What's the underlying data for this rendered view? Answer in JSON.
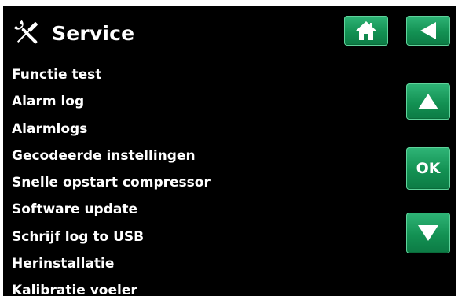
{
  "header": {
    "icon": "tools-icon",
    "title": "Service"
  },
  "menu": {
    "items": [
      {
        "label": "Functie test"
      },
      {
        "label": "Alarm log"
      },
      {
        "label": "Alarmlogs"
      },
      {
        "label": "Gecodeerde instellingen"
      },
      {
        "label": "Snelle opstart compressor"
      },
      {
        "label": "Software update"
      },
      {
        "label": "Schrijf log to USB"
      },
      {
        "label": "Herinstallatie"
      },
      {
        "label": "Kalibratie voeler"
      }
    ]
  },
  "buttons": {
    "home_icon": "home-icon",
    "back_icon": "back-arrow-icon",
    "up_icon": "up-arrow-icon",
    "ok_label": "OK",
    "down_icon": "down-arrow-icon"
  },
  "colors": {
    "background": "#000000",
    "text": "#ffffff",
    "button_green": "#139153"
  }
}
